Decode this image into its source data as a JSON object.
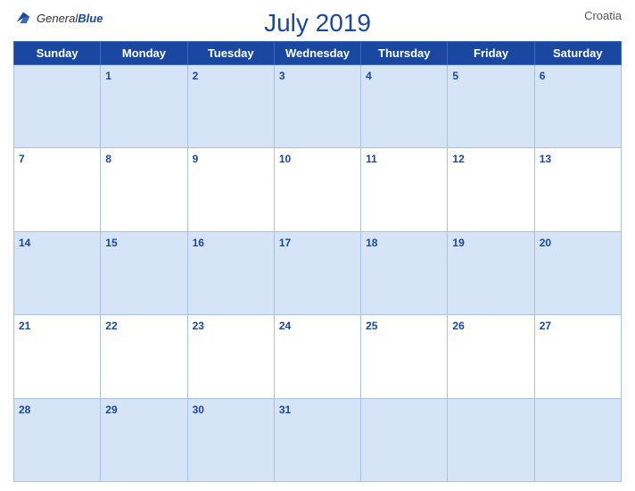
{
  "header": {
    "title": "July 2019",
    "country": "Croatia",
    "logo_general": "General",
    "logo_blue": "Blue"
  },
  "weekdays": [
    "Sunday",
    "Monday",
    "Tuesday",
    "Wednesday",
    "Thursday",
    "Friday",
    "Saturday"
  ],
  "weeks": [
    [
      null,
      1,
      2,
      3,
      4,
      5,
      6
    ],
    [
      7,
      8,
      9,
      10,
      11,
      12,
      13
    ],
    [
      14,
      15,
      16,
      17,
      18,
      19,
      20
    ],
    [
      21,
      22,
      23,
      24,
      25,
      26,
      27
    ],
    [
      28,
      29,
      30,
      31,
      null,
      null,
      null
    ]
  ],
  "row_shading": [
    "shaded",
    "white",
    "shaded",
    "white",
    "shaded"
  ]
}
